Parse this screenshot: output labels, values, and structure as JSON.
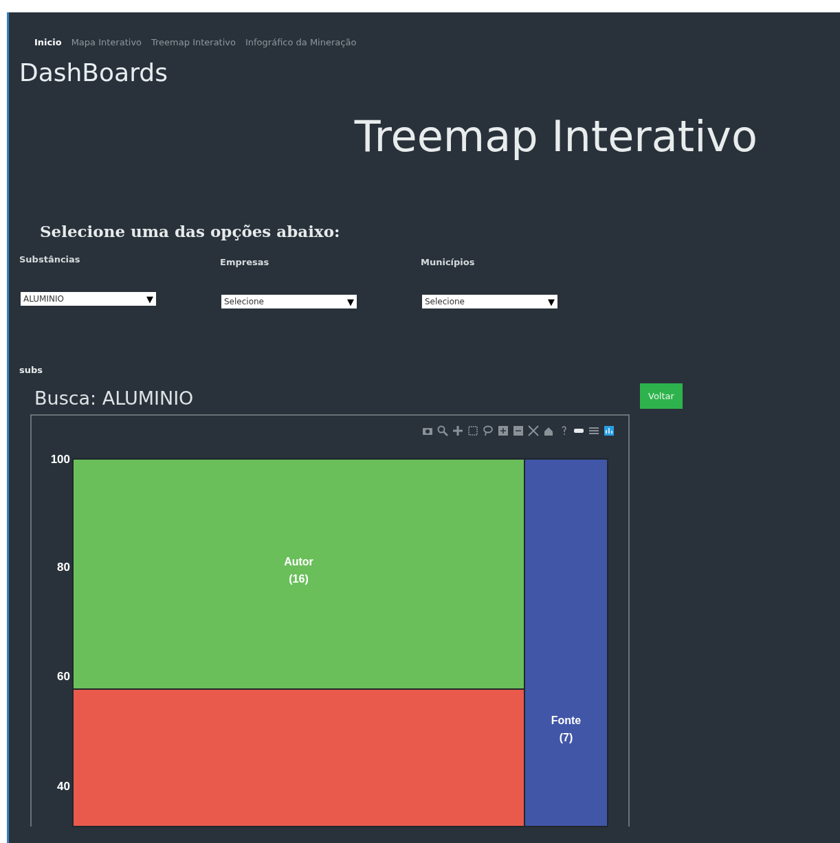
{
  "nav": [
    {
      "label": "Inicio",
      "selected": true
    },
    {
      "label": "Mapa Interativo",
      "selected": false
    },
    {
      "label": "Treemap Interativo",
      "selected": false
    },
    {
      "label": "Infográfico da Mineração",
      "selected": false
    }
  ],
  "brand": "DashBoards",
  "page_title": "Treemap Interativo",
  "prompt": "Selecione uma das opções abaixo:",
  "filters": [
    {
      "label": "Substâncias",
      "value": "ALUMINIO",
      "arrow": "▼"
    },
    {
      "label": "Empresas",
      "value": "Selecione",
      "arrow": "▼"
    },
    {
      "label": "Municípios",
      "value": "Selecione",
      "arrow": "▼"
    }
  ],
  "section_label": "subs",
  "search_title": "Busca: ALUMINIO",
  "back_button": "Voltar",
  "treemap": {
    "y_ticks": [
      "100",
      "80",
      "60",
      "40"
    ],
    "tiles": [
      {
        "label": "Autor",
        "count": "(16)",
        "color": "#6abf5a"
      },
      {
        "color": "#ea5a4c"
      },
      {
        "label": "Fonte",
        "count": "(7)",
        "color": "#4256a8"
      }
    ]
  }
}
